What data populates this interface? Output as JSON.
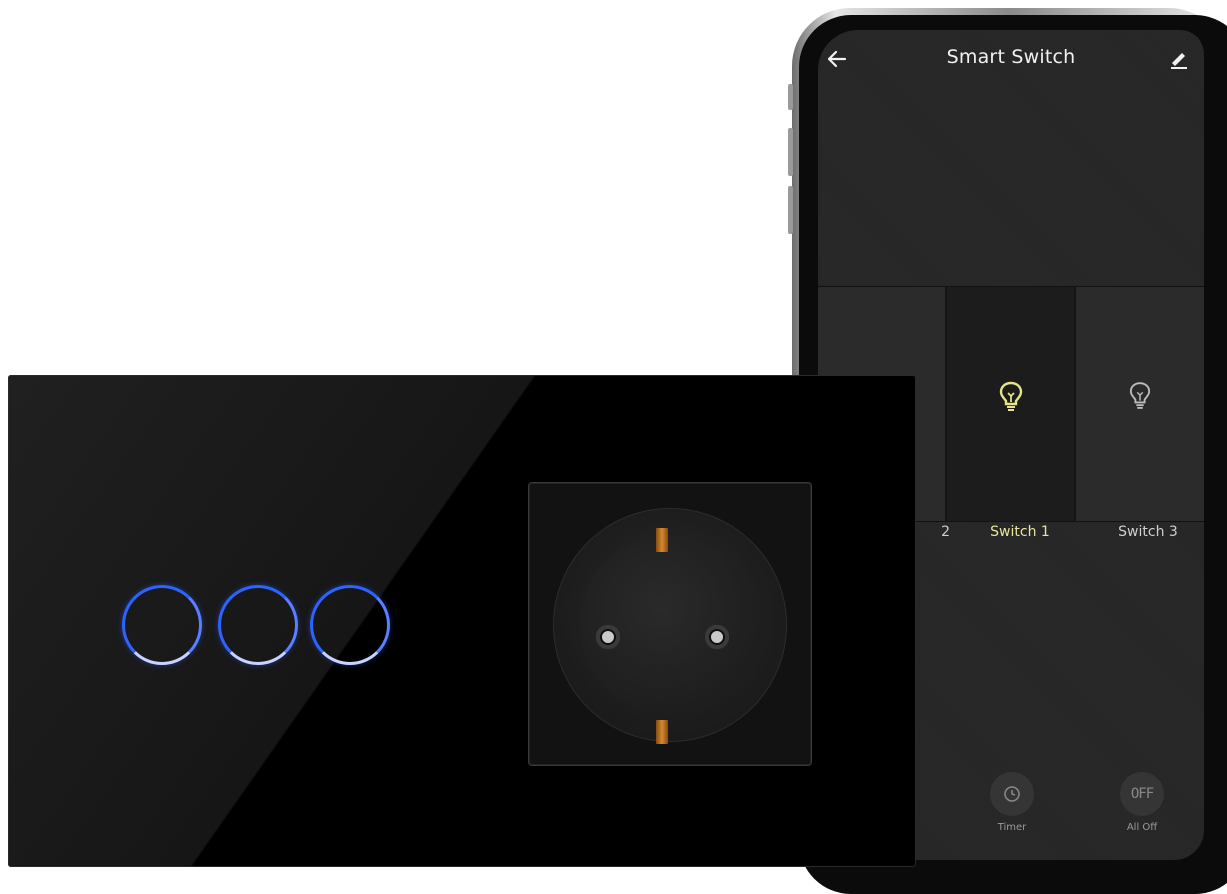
{
  "app": {
    "title": "Smart Switch",
    "back_icon": "arrow-left-icon",
    "edit_icon": "pencil-icon"
  },
  "switches": [
    {
      "label": "2",
      "state": "off",
      "icon": "lightbulb-icon"
    },
    {
      "label": "Switch 1",
      "state": "on",
      "icon": "lightbulb-icon"
    },
    {
      "label": "Switch 3",
      "state": "off",
      "icon": "lightbulb-icon"
    }
  ],
  "bottom_controls": {
    "timer_label": "Timer",
    "timer_icon": "clock-icon",
    "alloff_label": "All Off",
    "alloff_glyph": "OFF"
  },
  "colors": {
    "active_label": "#e8e4a0",
    "active_bulb": "#e6e38a",
    "touch_ring": "#2f63ff"
  }
}
